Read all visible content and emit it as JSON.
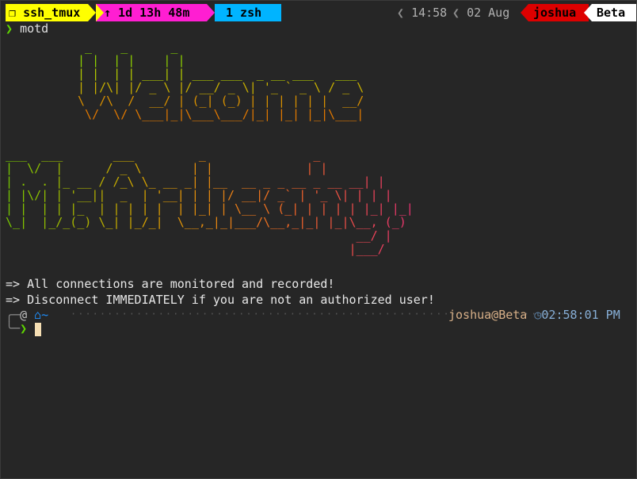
{
  "statusbar": {
    "session": "ssh_tmux",
    "session_icon": "square-icon",
    "uptime": "↑ 1d 13h 48m",
    "window": "1 zsh",
    "time": "14:58",
    "date": "02 Aug",
    "user": "joshua",
    "host": "Beta",
    "colors": {
      "session": "#ffff00",
      "uptime": "#ff1ed2",
      "window": "#00b4ff",
      "user": "#dd0000",
      "host": "#ffffff"
    }
  },
  "command": {
    "prompt": "❯",
    "text": "motd"
  },
  "banner": {
    "welcome": "  _    _      _\n | |  | |    | |\n | |  | | ___| | ___ ___  _ __ ___   ___\n | |/\\| |/ _ \\ |/ __/ _ \\| '_ ` _ \\ / _ \\\n \\  /\\  /  __/ | (_| (_) | | | | | |  __/\n  \\/  \\/ \\___|_|\\___\\___/|_| |_| |_|\\___|",
    "host_lines": [
      "___  ___       ___         _               _",
      "|  \\/  |      / _ \\       | |             | |",
      "| .  . |_ __ / /_\\ \\_ __ _| |__  __ _ _ __ _ __ __| |",
      "| |\\/| | '__||  _  | '__| | | |/ __|/ _` | '_ \\| | | |",
      "| |  | | |_  | | | | |  | |_| | \\__ \\ (_| | | | | |_| |_|",
      "\\_|  |_/_(_) \\_| |_/_|  \\__,_|_|___/\\__,_|_| |_|\\__, (_)",
      "                                                 __/ |",
      "                                                |___/"
    ]
  },
  "messages": [
    "=> All connections are monitored and recorded!",
    "=> Disconnect IMMEDIATELY if you are not an authorized user!"
  ],
  "prompt": {
    "dir": "~",
    "user_host": "joshua@Beta",
    "time": "02:58:01 PM",
    "symbol": "❯"
  }
}
